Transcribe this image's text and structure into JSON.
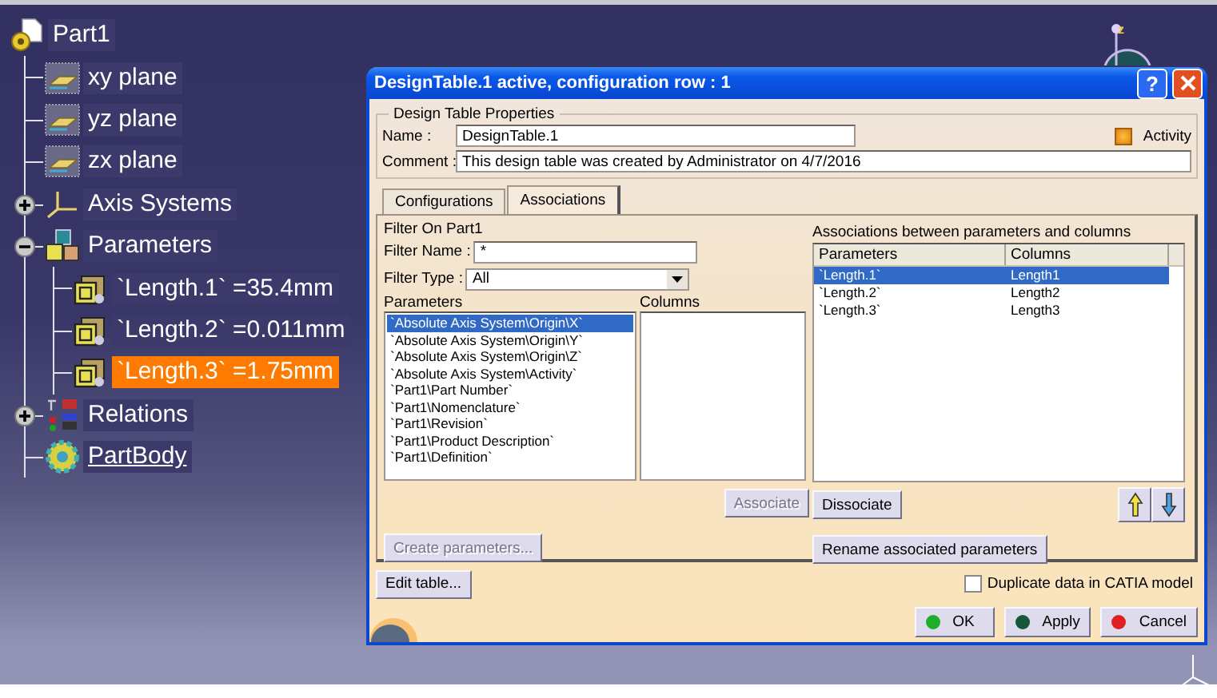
{
  "tree": {
    "label": "Part1",
    "kind": "part",
    "selected": false,
    "children": [
      {
        "label": "xy plane",
        "kind": "plane",
        "selected": false
      },
      {
        "label": "yz plane",
        "kind": "plane",
        "selected": false
      },
      {
        "label": "zx plane",
        "kind": "plane",
        "selected": false
      },
      {
        "label": "Axis Systems",
        "kind": "axis",
        "selected": false,
        "expanded": false
      },
      {
        "label": "Parameters",
        "kind": "parameters",
        "selected": false,
        "expanded": true,
        "children": [
          {
            "label": "`Length.1` =35.4mm",
            "kind": "parameter",
            "selected": false
          },
          {
            "label": "`Length.2` =0.011mm",
            "kind": "parameter",
            "selected": false
          },
          {
            "label": "`Length.3` =1.75mm",
            "kind": "parameter",
            "selected": true
          }
        ]
      },
      {
        "label": "Relations",
        "kind": "relations",
        "selected": false,
        "expanded": false
      },
      {
        "label": "PartBody",
        "kind": "body",
        "selected": false
      }
    ]
  },
  "compass": {
    "label": "z"
  },
  "dialog": {
    "title": "DesignTable.1 active, configuration row : 1",
    "help_button": "?",
    "properties": {
      "legend": "Design Table Properties",
      "name_label": "Name :",
      "name": "DesignTable.1",
      "comment_label": "Comment :",
      "comment": "This design table was created by Administrator on 4/7/2016",
      "activity": {
        "label": "Activity",
        "checked": true
      }
    },
    "tabs": [
      {
        "label": "Configurations",
        "selected": false
      },
      {
        "label": "Associations",
        "selected": true
      }
    ],
    "filter": {
      "title": "Filter On Part1",
      "name_label": "Filter Name :",
      "name": "*",
      "type_label": "Filter Type :",
      "type": "All"
    },
    "parameters": {
      "label": "Parameters",
      "items": [
        {
          "label": "`Absolute Axis System\\Origin\\X`",
          "selected": true
        },
        {
          "label": "`Absolute Axis System\\Origin\\Y`",
          "selected": false
        },
        {
          "label": "`Absolute Axis System\\Origin\\Z`",
          "selected": false
        },
        {
          "label": "`Absolute Axis System\\Activity`",
          "selected": false
        },
        {
          "label": "`Part1\\Part Number`",
          "selected": false
        },
        {
          "label": "`Part1\\Nomenclature`",
          "selected": false
        },
        {
          "label": "`Part1\\Revision`",
          "selected": false
        },
        {
          "label": "`Part1\\Product Description`",
          "selected": false
        },
        {
          "label": "`Part1\\Definition`",
          "selected": false
        }
      ]
    },
    "columns": {
      "label": "Columns"
    },
    "associations": {
      "label": "Associations between parameters and columns",
      "columns": [
        "Parameters",
        "Columns"
      ],
      "rows": [
        {
          "cells": [
            "`Length.1`",
            "Length1"
          ],
          "selected": true
        },
        {
          "cells": [
            "`Length.2`",
            "Length2"
          ],
          "selected": false
        },
        {
          "cells": [
            "`Length.3`",
            "Length3"
          ],
          "selected": false
        }
      ]
    },
    "associate": {
      "label": "Associate",
      "disabled": true
    },
    "dissociate": {
      "label": "Dissociate",
      "disabled": false
    },
    "create_parameters": {
      "label": "Create parameters...",
      "disabled": true
    },
    "rename": {
      "label": "Rename associated parameters",
      "disabled": false
    },
    "edit_table": {
      "label": "Edit table..."
    },
    "duplicate": {
      "label": "Duplicate data in CATIA model",
      "checked": false
    },
    "actions": [
      {
        "label": "OK",
        "color": "#1fae2a"
      },
      {
        "label": "Apply",
        "color": "#17583a"
      },
      {
        "label": "Cancel",
        "color": "#e02020"
      }
    ]
  }
}
